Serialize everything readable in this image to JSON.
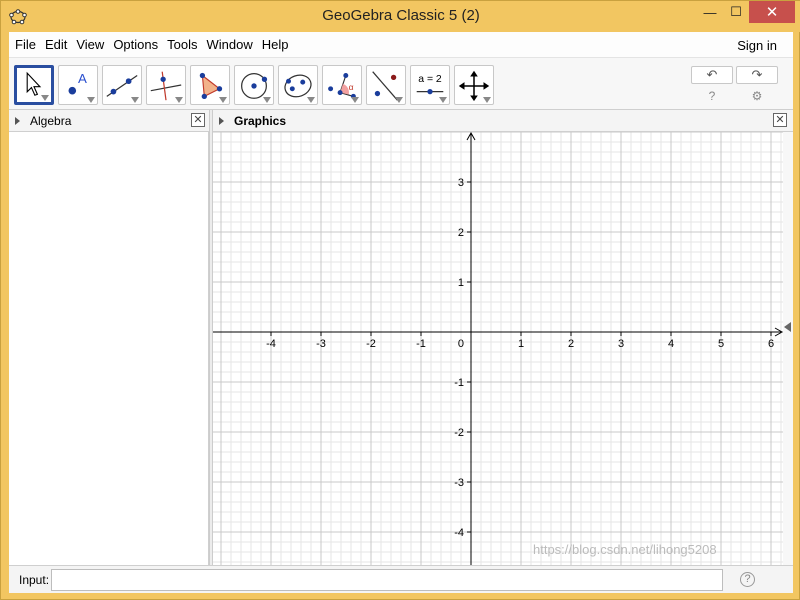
{
  "window": {
    "title": "GeoGebra Classic 5 (2)",
    "min_glyph": "—",
    "max_glyph": "☐",
    "close_glyph": "✕"
  },
  "menubar": {
    "items": [
      "File",
      "Edit",
      "View",
      "Options",
      "Tools",
      "Window",
      "Help"
    ],
    "sign_in": "Sign in"
  },
  "toolbar": {
    "tools": [
      {
        "name": "move-tool",
        "icon": "pointer-arrow-icon",
        "selected": true
      },
      {
        "name": "point-tool",
        "icon": "point-icon",
        "label": "A"
      },
      {
        "name": "line-tool",
        "icon": "line-icon"
      },
      {
        "name": "perpendicular-line-tool",
        "icon": "perpendicular-line-icon"
      },
      {
        "name": "polygon-tool",
        "icon": "polygon-icon"
      },
      {
        "name": "circle-tool",
        "icon": "circle-icon"
      },
      {
        "name": "ellipse-tool",
        "icon": "ellipse-icon"
      },
      {
        "name": "angle-tool",
        "icon": "angle-icon",
        "label": "α"
      },
      {
        "name": "reflect-tool",
        "icon": "reflect-icon"
      },
      {
        "name": "slider-tool",
        "icon": "slider-icon",
        "label": "a = 2"
      },
      {
        "name": "move-graphics-tool",
        "icon": "move-view-icon"
      }
    ],
    "undo_glyph": "↶",
    "redo_glyph": "↷",
    "help_glyph": "?",
    "settings_glyph": "⚙"
  },
  "algebra": {
    "title": "Algebra",
    "close_glyph": "✕"
  },
  "graphics": {
    "title": "Graphics",
    "close_glyph": "✕",
    "x_ticks": [
      "-4",
      "-3",
      "-2",
      "-1",
      "1",
      "2",
      "3",
      "4",
      "5",
      "6"
    ],
    "y_ticks": [
      "3",
      "2",
      "1",
      "-1",
      "-2",
      "-3",
      "-4"
    ],
    "origin_label": "0",
    "x_range": [
      -5.16,
      6.24
    ],
    "y_range": [
      -4.66,
      4.0
    ],
    "grid": true,
    "colors": {
      "major_grid": "#c8c8c8",
      "minor_grid": "#e6e6e6",
      "axis": "#000000"
    }
  },
  "input_bar": {
    "label": "Input:",
    "value": "",
    "help_glyph": "?"
  },
  "watermark": "https://blog.csdn.net/lihong5208"
}
